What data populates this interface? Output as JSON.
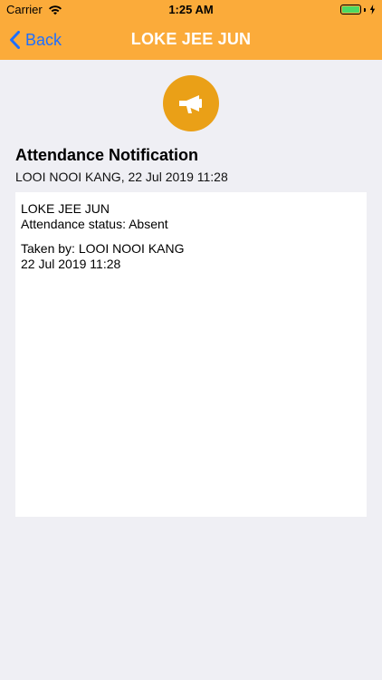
{
  "status_bar": {
    "carrier": "Carrier",
    "time": "1:25 AM",
    "battery_color": "#4cd964"
  },
  "nav": {
    "back_label": "Back",
    "title": "LOKE JEE JUN",
    "accent_color": "#1e6fff",
    "header_color": "#fbab3a"
  },
  "notification": {
    "icon": "megaphone-icon",
    "title": "Attendance Notification",
    "meta": "LOOI NOOI KANG, 22 Jul 2019 11:28",
    "body": {
      "line1": "LOKE JEE JUN",
      "line2": "Attendance status: Absent",
      "line3": "Taken by: LOOI NOOI KANG",
      "line4": "22 Jul 2019 11:28"
    }
  }
}
